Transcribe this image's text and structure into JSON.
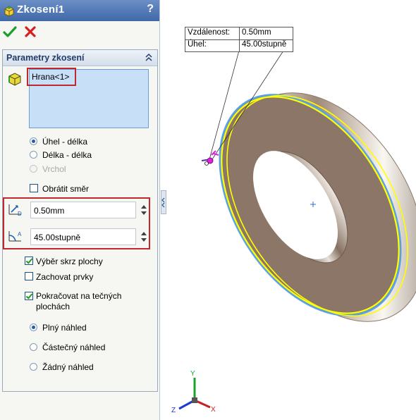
{
  "title": "Zkosení1",
  "help_label": "?",
  "group": {
    "title": "Parametry zkosení"
  },
  "selection": {
    "item": "Hrana<1>"
  },
  "options": {
    "angle_length": "Úhel - délka",
    "length_length": "Délka - délka",
    "vertex": "Vrchol",
    "flip_direction": "Obrátit směr"
  },
  "params": {
    "distance": "0.50mm",
    "angle": "45.00stupně"
  },
  "checks": {
    "select_through_faces": "Výběr skrz plochy",
    "keep_features": "Zachovat prvky",
    "tangent_line1": "Pokračovat na tečných",
    "tangent_line2": "plochách"
  },
  "preview": {
    "full": "Plný náhled",
    "partial": "Částečný náhled",
    "none": "Žádný náhled"
  },
  "callout": {
    "distance_label": "Vzdálenost:",
    "distance_value": "0.50mm",
    "angle_label": "Úhel:",
    "angle_value": "45.00stupně"
  },
  "triad": {
    "x": "X",
    "y": "Y",
    "z": "Z"
  },
  "colors": {
    "title_bar": "#4a72b4",
    "highlight_red": "#c0282e",
    "edge_yellow": "#ffff00",
    "preview_blue": "#5aa0e6"
  }
}
